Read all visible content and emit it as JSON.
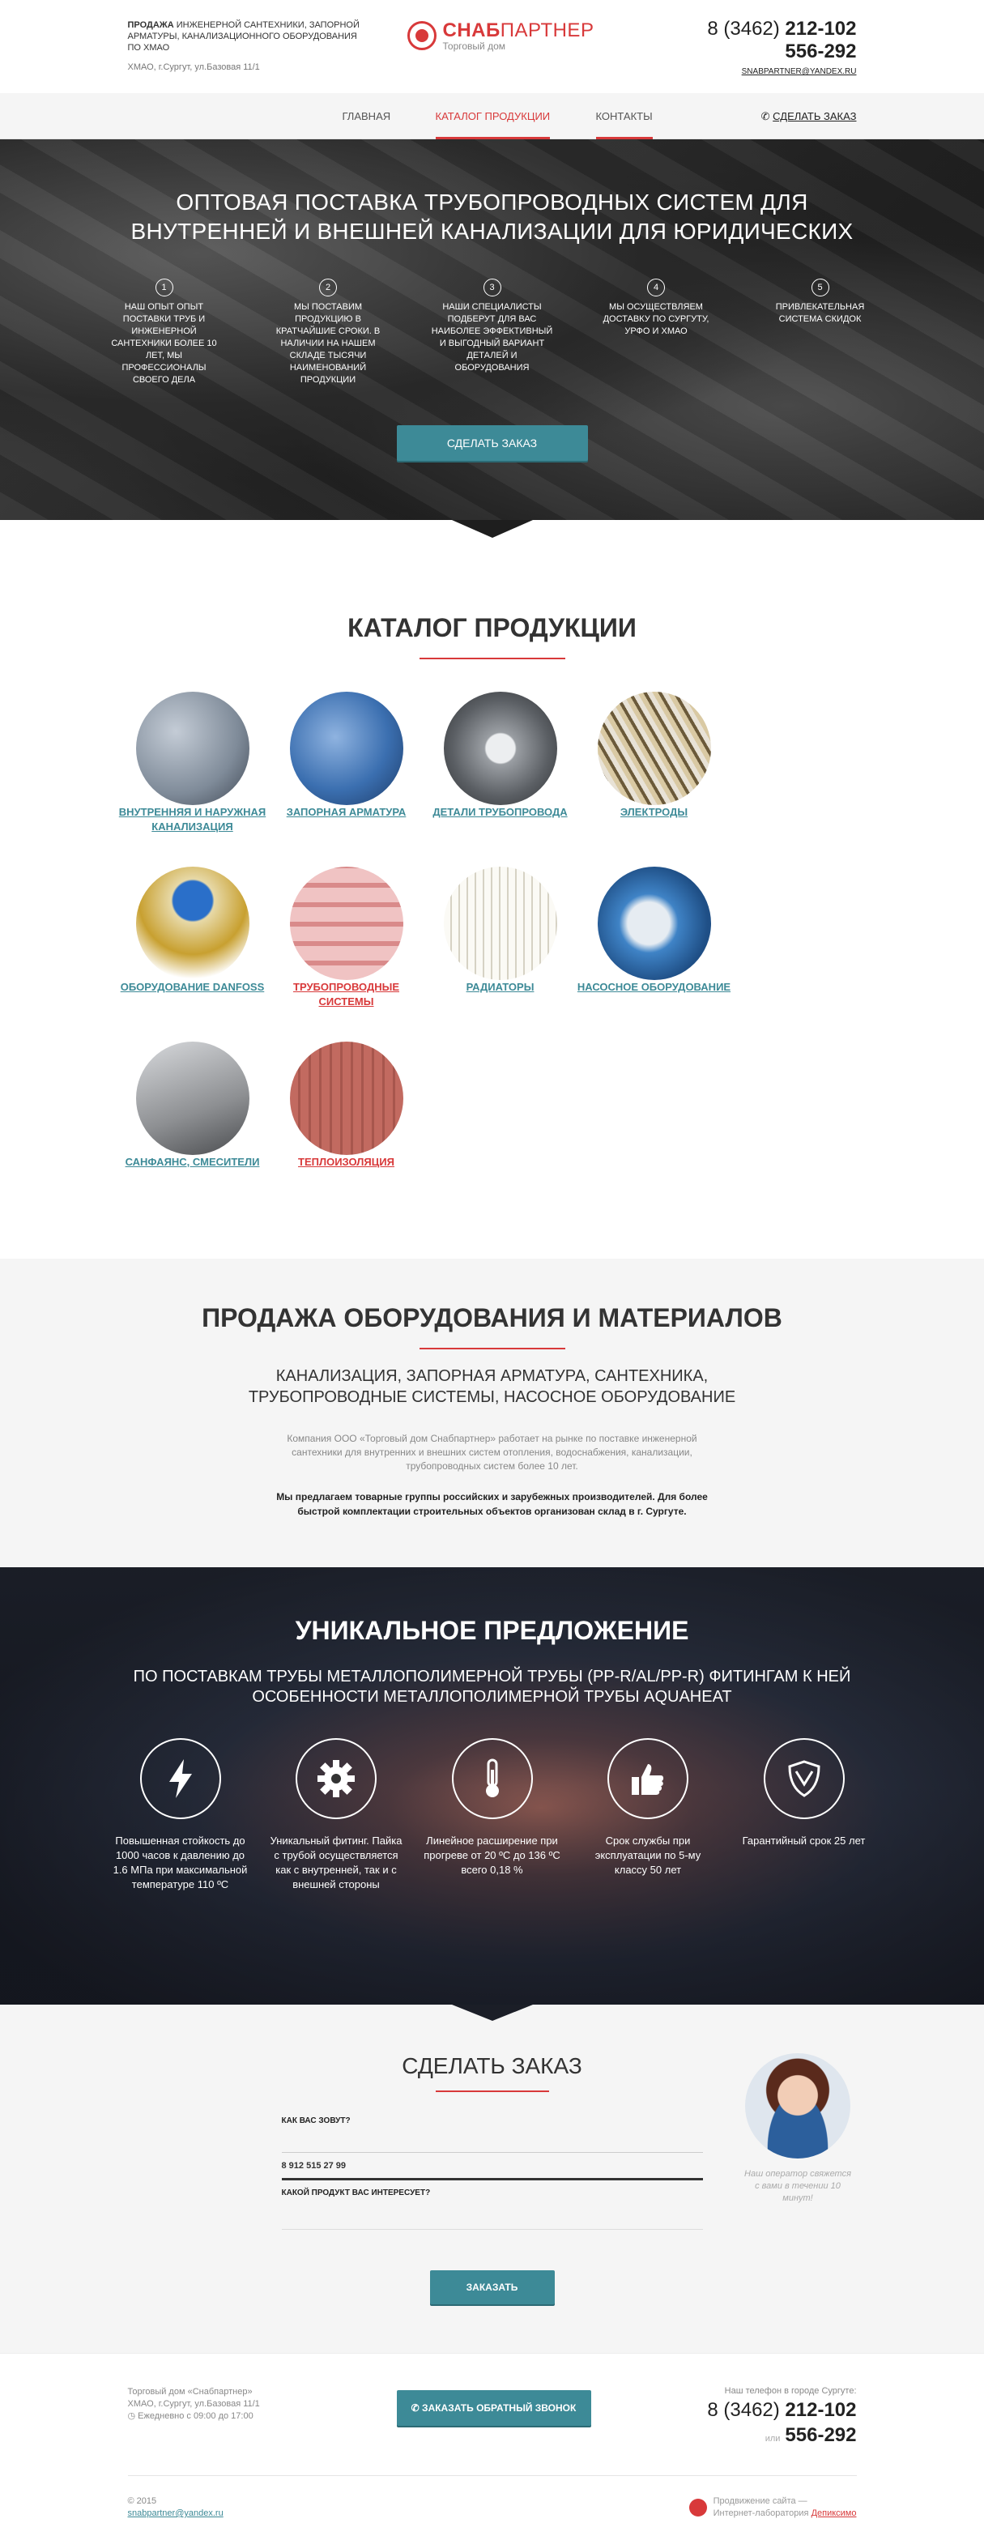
{
  "header": {
    "tagline_bold": "ПРОДАЖА",
    "tagline_rest": " ИНЖЕНЕРНОЙ САНТЕХНИКИ, ЗАПОРНОЙ АРМАТУРЫ, КАНАЛИЗАЦИОННОГО ОБОРУДОВАНИЯ ПО ХМАО",
    "address": "ХМАО, г.Сургут, ул.Базовая 11/1",
    "logo_title_bold": "СНАБ",
    "logo_title_rest": "ПАРТНЕР",
    "logo_sub": "Торговый дом",
    "phone_code": "8 (3462) ",
    "phone1": "212-102",
    "phone2": "556-292",
    "email": "SNABPARTNER@YANDEX.RU"
  },
  "nav": {
    "items": [
      "ГЛАВНАЯ",
      "КАТАЛОГ ПРОДУКЦИИ",
      "КОНТАКТЫ"
    ],
    "order_label": "СДЕЛАТЬ ЗАКАЗ"
  },
  "hero": {
    "title_line1": "ОПТОВАЯ ПОСТАВКА ТРУБОПРОВОДНЫХ СИСТЕМ ДЛЯ",
    "title_line2": "ВНУТРЕННЕЙ И ВНЕШНЕЙ КАНАЛИЗАЦИИ ДЛЯ ЮРИДИЧЕСКИХ",
    "features": [
      {
        "num": "1",
        "text": "НАШ ОПЫТ ОПЫТ ПОСТАВКИ ТРУБ И ИНЖЕНЕРНОЙ САНТЕХНИКИ БОЛЕЕ 10 ЛЕТ, МЫ ПРОФЕССИОНАЛЫ СВОЕГО ДЕЛА"
      },
      {
        "num": "2",
        "text": "МЫ ПОСТАВИМ ПРОДУКЦИЮ В КРАТЧАЙШИЕ СРОКИ. В НАЛИЧИИ НА НАШЕМ СКЛАДЕ ТЫСЯЧИ НАИМЕНОВАНИЙ ПРОДУКЦИИ"
      },
      {
        "num": "3",
        "text": "НАШИ СПЕЦИАЛИСТЫ ПОДБЕРУТ ДЛЯ ВАС НАИБОЛЕЕ ЭФФЕКТИВНЫЙ И ВЫГОДНЫЙ ВАРИАНТ ДЕТАЛЕЙ И ОБОРУДОВАНИЯ"
      },
      {
        "num": "4",
        "text": "МЫ ОСУЩЕСТВЛЯЕМ ДОСТАВКУ ПО СУРГУТУ, УРФО И ХМАО"
      },
      {
        "num": "5",
        "text": "ПРИВЛЕКАТЕЛЬНАЯ СИСТЕМА СКИДОК"
      }
    ],
    "button": "СДЕЛАТЬ ЗАКАЗ"
  },
  "catalog": {
    "title": "КАТАЛОГ ПРОДУКЦИИ",
    "items": [
      {
        "label": "ВНУТРЕННЯЯ И НАРУЖНАЯ КАНАЛИЗАЦИЯ",
        "color": "#7f8b99"
      },
      {
        "label": "ЗАПОРНАЯ АРМАТУРА",
        "color": "#3b6fb0"
      },
      {
        "label": "ДЕТАЛИ ТРУБОПРОВОДА",
        "color": "#9a9ea3"
      },
      {
        "label": "ЭЛЕКТРОДЫ",
        "color": "#b8a37a"
      },
      {
        "label": "ОБОРУДОВАНИЕ DANFOSS",
        "color": "#c8a030"
      },
      {
        "label": "ТРУБОПРОВОДНЫЕ СИСТЕМЫ",
        "color": "#d98a8a"
      },
      {
        "label": "РАДИАТОРЫ",
        "color": "#e7d9a8"
      },
      {
        "label": "НАСОСНОЕ ОБОРУДОВАНИЕ",
        "color": "#3f83c6"
      },
      {
        "label": "САНФАЯНС, СМЕСИТЕЛИ",
        "color": "#8d8f92"
      },
      {
        "label": "ТЕПЛОИЗОЛЯЦИЯ",
        "color": "#c26a60"
      }
    ]
  },
  "sales": {
    "title": "ПРОДАЖА ОБОРУДОВАНИЯ И МАТЕРИАЛОВ",
    "sub_line1": "КАНАЛИЗАЦИЯ, ЗАПОРНАЯ АРМАТУРА, САНТЕХНИКА,",
    "sub_line2": "ТРУБОПРОВОДНЫЕ СИСТЕМЫ, НАСОСНОЕ ОБОРУДОВАНИЕ",
    "text": "Компания ООО «Торговый дом Снабпартнер» работает на рынке по поставке инженерной сантехники для внутренних и внешних систем отопления, водоснабжения, канализации, трубопроводных систем более 10 лет.",
    "bold": "Мы предлагаем товарные группы российских и зарубежных производителей. Для более быстрой комплектации строительных объектов организован склад в г. Сургуте."
  },
  "unique": {
    "title": "УНИКАЛЬНОЕ ПРЕДЛОЖЕНИЕ",
    "sub_line1": "ПО ПОСТАВКАМ ТРУБЫ МЕТАЛЛОПОЛИМЕРНОЙ ТРУБЫ (PP-R/AL/PP-R) ФИТИНГАМ К НЕЙ",
    "sub_line2": "ОСОБЕННОСТИ МЕТАЛЛОПОЛИМЕРНОЙ  ТРУБЫ AQUAHEAT",
    "features": [
      {
        "icon": "lightning-icon",
        "text": "Повышенная стойкость до 1000 часов к давлению до 1.6 МПа  при максимальной температуре 110 ºС"
      },
      {
        "icon": "gear-icon",
        "text": "Уникальный фитинг. Пайка с трубой осуществляется как с внутренней, так и с внешней стороны"
      },
      {
        "icon": "thermometer-icon",
        "text": "Линейное расширение при прогреве от 20 ºС до 136 ºС всего 0,18 %"
      },
      {
        "icon": "thumbs-up-icon",
        "text": "Срок службы при эксплуатации по 5-му классу 50 лет"
      },
      {
        "icon": "shield-icon",
        "text": "Гарантийный срок 25 лет"
      }
    ]
  },
  "order": {
    "title": "СДЕЛАТЬ ЗАКАЗ",
    "name_label": "КАК ВАС ЗОВУТ?",
    "name_value": "",
    "phone_value": "8 912 515 27 99",
    "product_label": "КАКОЙ ПРОДУКТ ВАС ИНТЕРЕСУЕТ?",
    "product_value": "",
    "button": "ЗАКАЗАТЬ",
    "operator_text": "Наш оператор свяжется с вами в течении 10 минут!"
  },
  "footer": {
    "company": "Торговый дом «Снабпартнер»",
    "address": "ХМАО, г.Сургут, ул.Базовая 11/1",
    "hours": "Ежедневно с 09:00 до 17:00",
    "callback_button": "ЗАКАЗАТЬ ОБРАТНЫЙ ЗВОНОК",
    "phone_label": "Наш телефон в городе Сургуте:",
    "phone_code": "8 (3462) ",
    "phone1": "212-102",
    "or": "или",
    "phone2": "556-292",
    "copyright": "© 2015",
    "email": "snabpartner@yandex.ru",
    "dev_line1": "Продвижение сайта —",
    "dev_line2": "Интернет-лаборатория ",
    "dev_name": "Депиксимо"
  }
}
